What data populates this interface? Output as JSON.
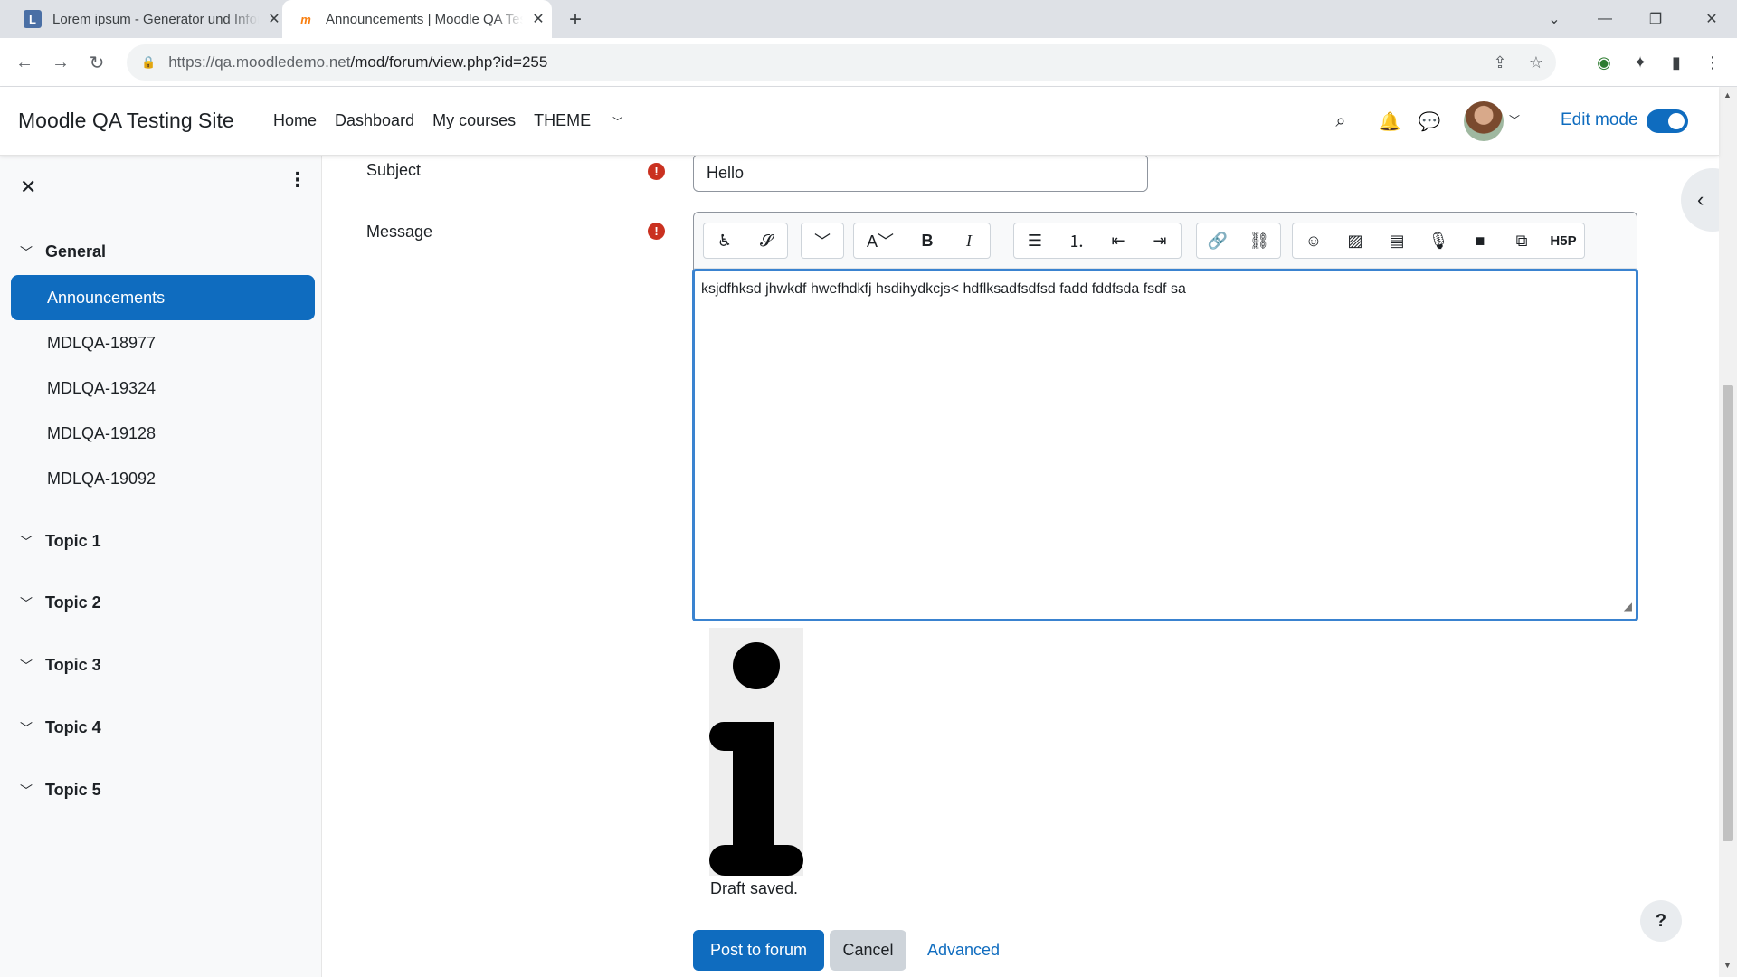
{
  "browser": {
    "tabs": [
      {
        "title": "Lorem ipsum - Generator und Informationen",
        "favicon": "L"
      },
      {
        "title": "Announcements | Moodle QA Testing Site",
        "favicon": "m"
      }
    ],
    "url_host": "https://qa.moodledemo.net",
    "url_path": "/mod/forum/view.php?id=255"
  },
  "navbar": {
    "brand": "Moodle QA Testing Site",
    "links": [
      "Home",
      "Dashboard",
      "My courses",
      "THEME"
    ],
    "edit_mode_label": "Edit mode"
  },
  "drawer": {
    "sections": [
      {
        "title": "General",
        "items": [
          "Announcements",
          "MDLQA-18977",
          "MDLQA-19324",
          "MDLQA-19128",
          "MDLQA-19092"
        ]
      },
      {
        "title": "Topic 1"
      },
      {
        "title": "Topic 2"
      },
      {
        "title": "Topic 3"
      },
      {
        "title": "Topic 4"
      },
      {
        "title": "Topic 5"
      }
    ],
    "active_item": "Announcements"
  },
  "form": {
    "subject_label": "Subject",
    "subject_value": "Hello",
    "message_label": "Message",
    "message_text": "ksjdfhksd jhwkdf hwefhdkfj hsdihydkcjs< hdflksadfsdfsd fadd fddfsda fsdf sa",
    "draft_status": "Draft saved.",
    "post_button": "Post to forum",
    "cancel_button": "Cancel",
    "advanced_link": "Advanced",
    "toolbar_h5p_label": "H5P"
  },
  "help_label": "?",
  "colors": {
    "primary": "#0f6cbf",
    "required": "#ca3120",
    "focus": "#3a83d0"
  }
}
